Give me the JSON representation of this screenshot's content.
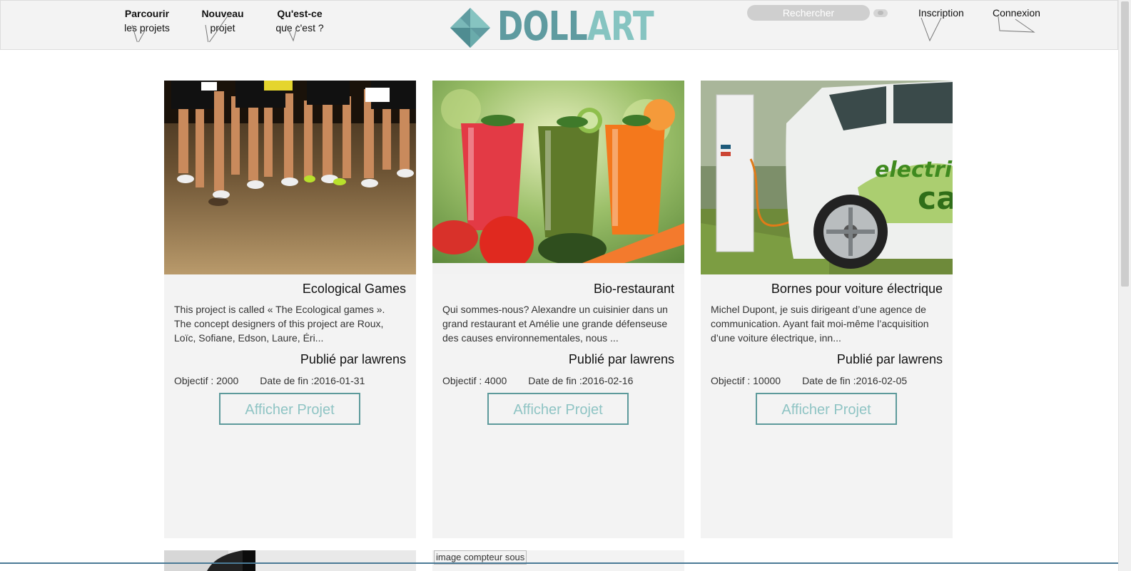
{
  "header": {
    "nav": [
      {
        "bold": "Parcourir",
        "light": "les projets"
      },
      {
        "bold": "Nouveau",
        "light": "projet"
      },
      {
        "bold": "Qu'est-ce",
        "light": "que c'est ?"
      }
    ],
    "logo": {
      "part1": "DOLL",
      "part2": "ART"
    },
    "search_placeholder": "Rechercher",
    "inscription": "Inscription",
    "connexion": "Connexion"
  },
  "cards": [
    {
      "title": "Ecological Games",
      "description": "This project is called « The Ecological games ». The concept designers of this project are Roux, Loïc, Sofiane, Edson, Laure, Éri...",
      "author": "Publié par lawrens",
      "goal": "Objectif : 2000",
      "end_date": "Date de fin :2016-01-31",
      "button": "Afficher Projet"
    },
    {
      "title": "Bio-restaurant",
      "description": "Qui sommes-nous? Alexandre un cuisinier dans un grand restaurant et Amélie une grande défenseuse des causes environnementales, nous ...",
      "author": "Publié par lawrens",
      "goal": "Objectif : 4000",
      "end_date": "Date de fin :2016-02-16",
      "button": "Afficher Projet"
    },
    {
      "title": "Bornes pour voiture électrique",
      "description": "Michel Dupont, je suis dirigeant d’une agence de communication. Ayant fait moi-même l’acquisition d’une voiture électrique, inn...",
      "author": "Publié par lawrens",
      "goal": "Objectif : 10000",
      "end_date": "Date de fin :2016-02-05",
      "button": "Afficher Projet"
    }
  ],
  "bottom": {
    "broken_image_alt": "image compteur sous"
  },
  "car_decal": {
    "line1": "electric",
    "line2": "ca"
  },
  "colors": {
    "accent": "#5f9ba0",
    "accent_light": "#86c4c1",
    "card_bg": "#f3f3f3",
    "header_bg": "#f3f3f3"
  }
}
